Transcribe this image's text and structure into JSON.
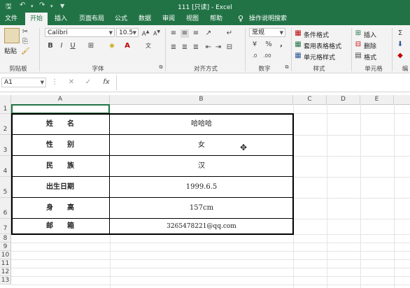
{
  "title": "111 [只读] - Excel",
  "tabs": [
    "文件",
    "开始",
    "插入",
    "页面布局",
    "公式",
    "数据",
    "审阅",
    "视图",
    "帮助"
  ],
  "tell_me": "操作说明搜索",
  "ribbon": {
    "paste": "粘贴",
    "font_name": "Calibri",
    "font_size": "10.5",
    "number_format": "常规",
    "conditional_format": "条件格式",
    "table_format": "套用表格格式",
    "cell_style": "单元格样式",
    "insert": "插入",
    "delete": "删除",
    "format": "格式",
    "groups": {
      "clipboard": "剪贴板",
      "font": "字体",
      "alignment": "对齐方式",
      "number": "数字",
      "styles": "样式",
      "cells": "单元格",
      "editing": "编"
    }
  },
  "formula_bar": {
    "name_box": "A1",
    "fx": "fx",
    "content": ""
  },
  "columns": [
    "A",
    "B",
    "C",
    "D",
    "E"
  ],
  "rows": [
    "1",
    "2",
    "3",
    "4",
    "5",
    "6",
    "7",
    "8",
    "9",
    "10",
    "11",
    "12",
    "13"
  ],
  "table": [
    {
      "label": "姓　　名",
      "value": "哈哈哈"
    },
    {
      "label": "性　　别",
      "value": "女"
    },
    {
      "label": "民　　族",
      "value": "汉"
    },
    {
      "label": "出生日期",
      "value": "1999.6.5"
    },
    {
      "label": "身　　高",
      "value": "157cm"
    },
    {
      "label": "邮　　箱",
      "value": "3265478221@qq.com"
    }
  ],
  "colors": {
    "accent": "#217346",
    "ribbon_bg": "#f3f3f3"
  }
}
